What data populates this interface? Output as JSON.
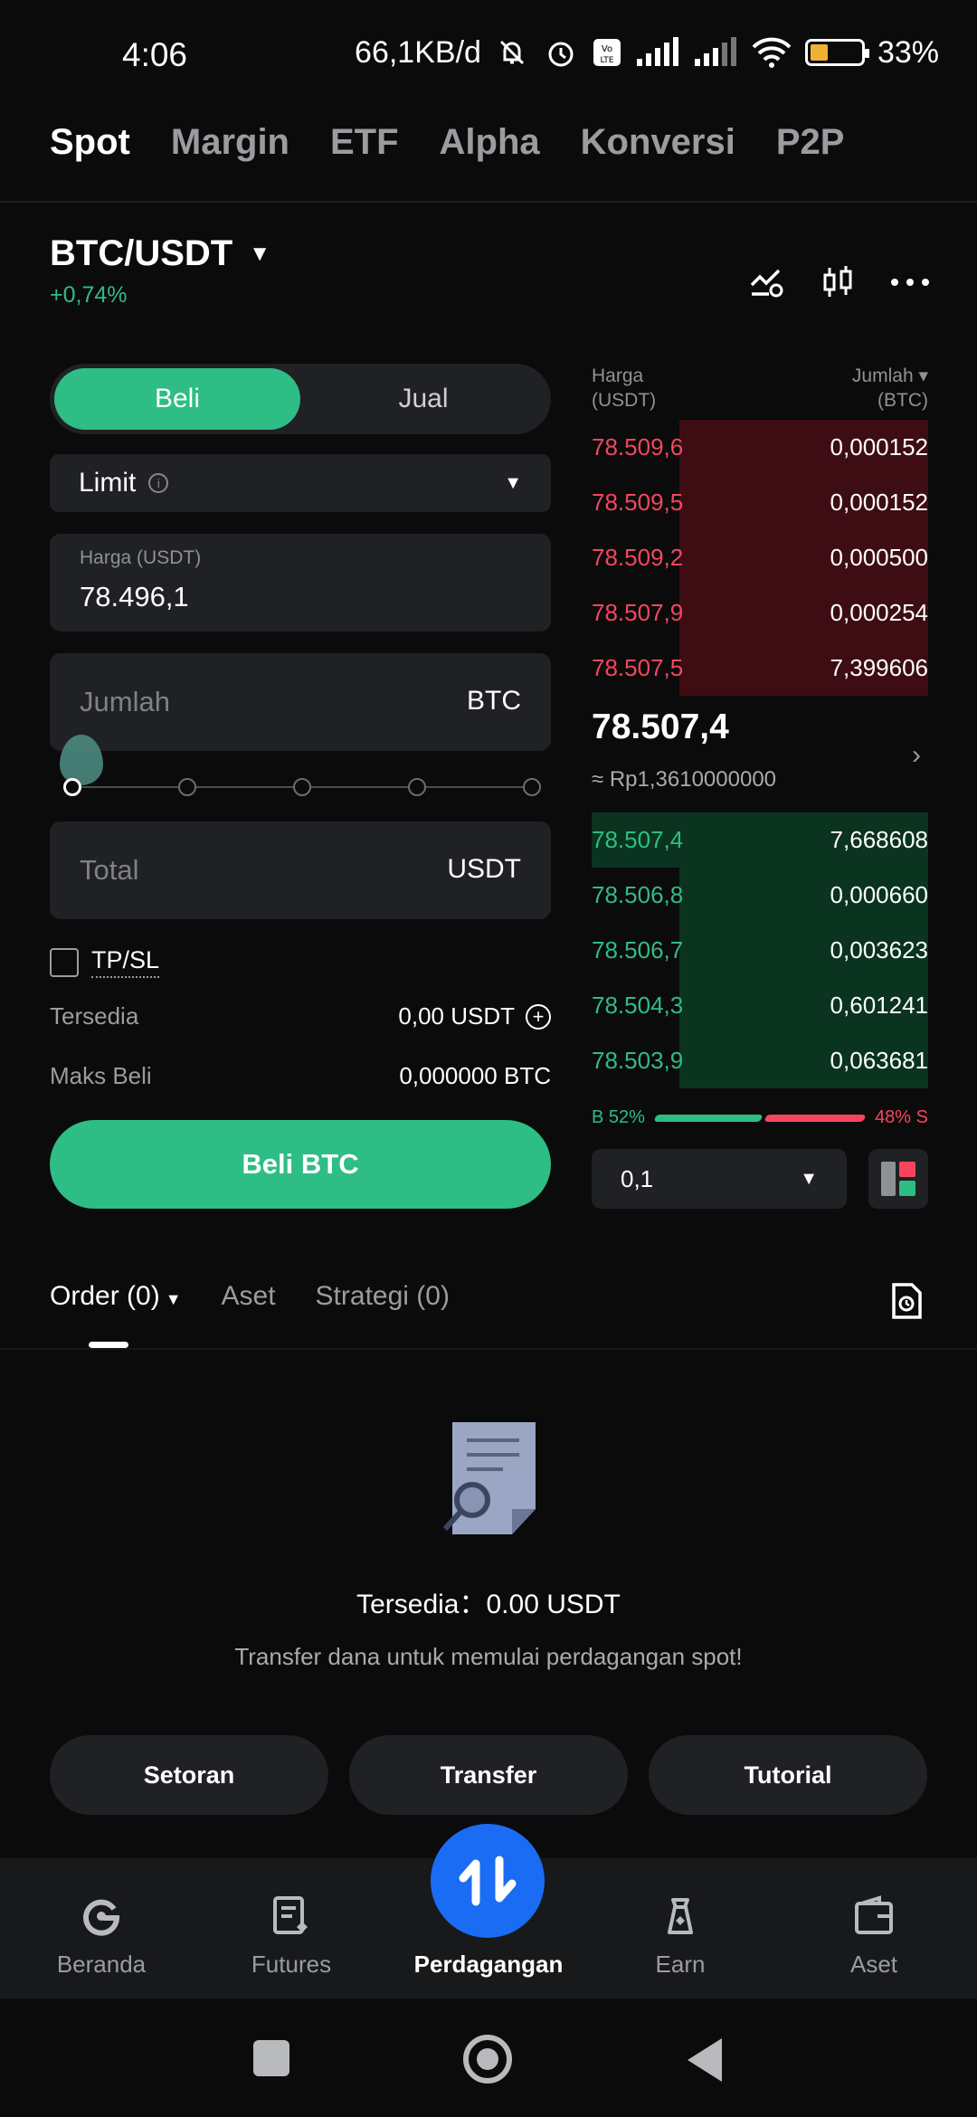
{
  "status_bar": {
    "time": "4:06",
    "net_speed": "66,1KB/d",
    "battery": "33%",
    "battery_level": 0.33
  },
  "top_tabs": [
    "Spot",
    "Margin",
    "ETF",
    "Alpha",
    "Konversi",
    "P2P"
  ],
  "pair": {
    "symbol": "BTC/USDT",
    "change": "+0,74%",
    "change_color": "#2ebd85"
  },
  "order_form": {
    "buy_label": "Beli",
    "sell_label": "Jual",
    "order_type": "Limit",
    "price_label": "Harga (USDT)",
    "price_value": "78.496,1",
    "amount_placeholder": "Jumlah",
    "amount_unit": "BTC",
    "total_placeholder": "Total",
    "total_unit": "USDT",
    "tpsl_label": "TP/SL",
    "available_label": "Tersedia",
    "available_value": "0,00 USDT",
    "max_buy_label": "Maks Beli",
    "max_buy_value": "0,000000 BTC",
    "submit_label": "Beli BTC",
    "buy_color": "#2ebd85"
  },
  "order_book": {
    "price_header": "Harga (USDT)",
    "amount_header": "Jumlah ▾ (BTC)",
    "asks": [
      {
        "price": "78.509,6",
        "amount": "0,000152"
      },
      {
        "price": "78.509,5",
        "amount": "0,000152"
      },
      {
        "price": "78.509,2",
        "amount": "0,000500"
      },
      {
        "price": "78.507,9",
        "amount": "0,000254"
      },
      {
        "price": "78.507,5",
        "amount": "7,399606"
      }
    ],
    "last_price": "78.507,4",
    "fiat_price": "≈ Rp1,3610000000",
    "bids": [
      {
        "price": "78.507,4",
        "amount": "7,668608"
      },
      {
        "price": "78.506,8",
        "amount": "0,000660"
      },
      {
        "price": "78.506,7",
        "amount": "0,003623"
      },
      {
        "price": "78.504,3",
        "amount": "0,601241"
      },
      {
        "price": "78.503,9",
        "amount": "0,063681"
      }
    ],
    "buy_ratio": "B 52%",
    "sell_ratio": "48% S",
    "precision": "0,1",
    "ask_color": "#f6465d",
    "bid_color": "#2ebd85"
  },
  "orders_tabs": {
    "orders": "Order (0)",
    "assets": "Aset",
    "strategy": "Strategi (0)"
  },
  "empty_state": {
    "available": "Tersedia：0.00 USDT",
    "hint": "Transfer dana untuk memulai perdagangan spot!"
  },
  "actions": [
    "Setoran",
    "Transfer",
    "Tutorial"
  ],
  "bottom_nav": {
    "home": "Beranda",
    "futures": "Futures",
    "trade": "Perdagangan",
    "earn": "Earn",
    "assets": "Aset",
    "fab_color": "#1a6cf5"
  }
}
